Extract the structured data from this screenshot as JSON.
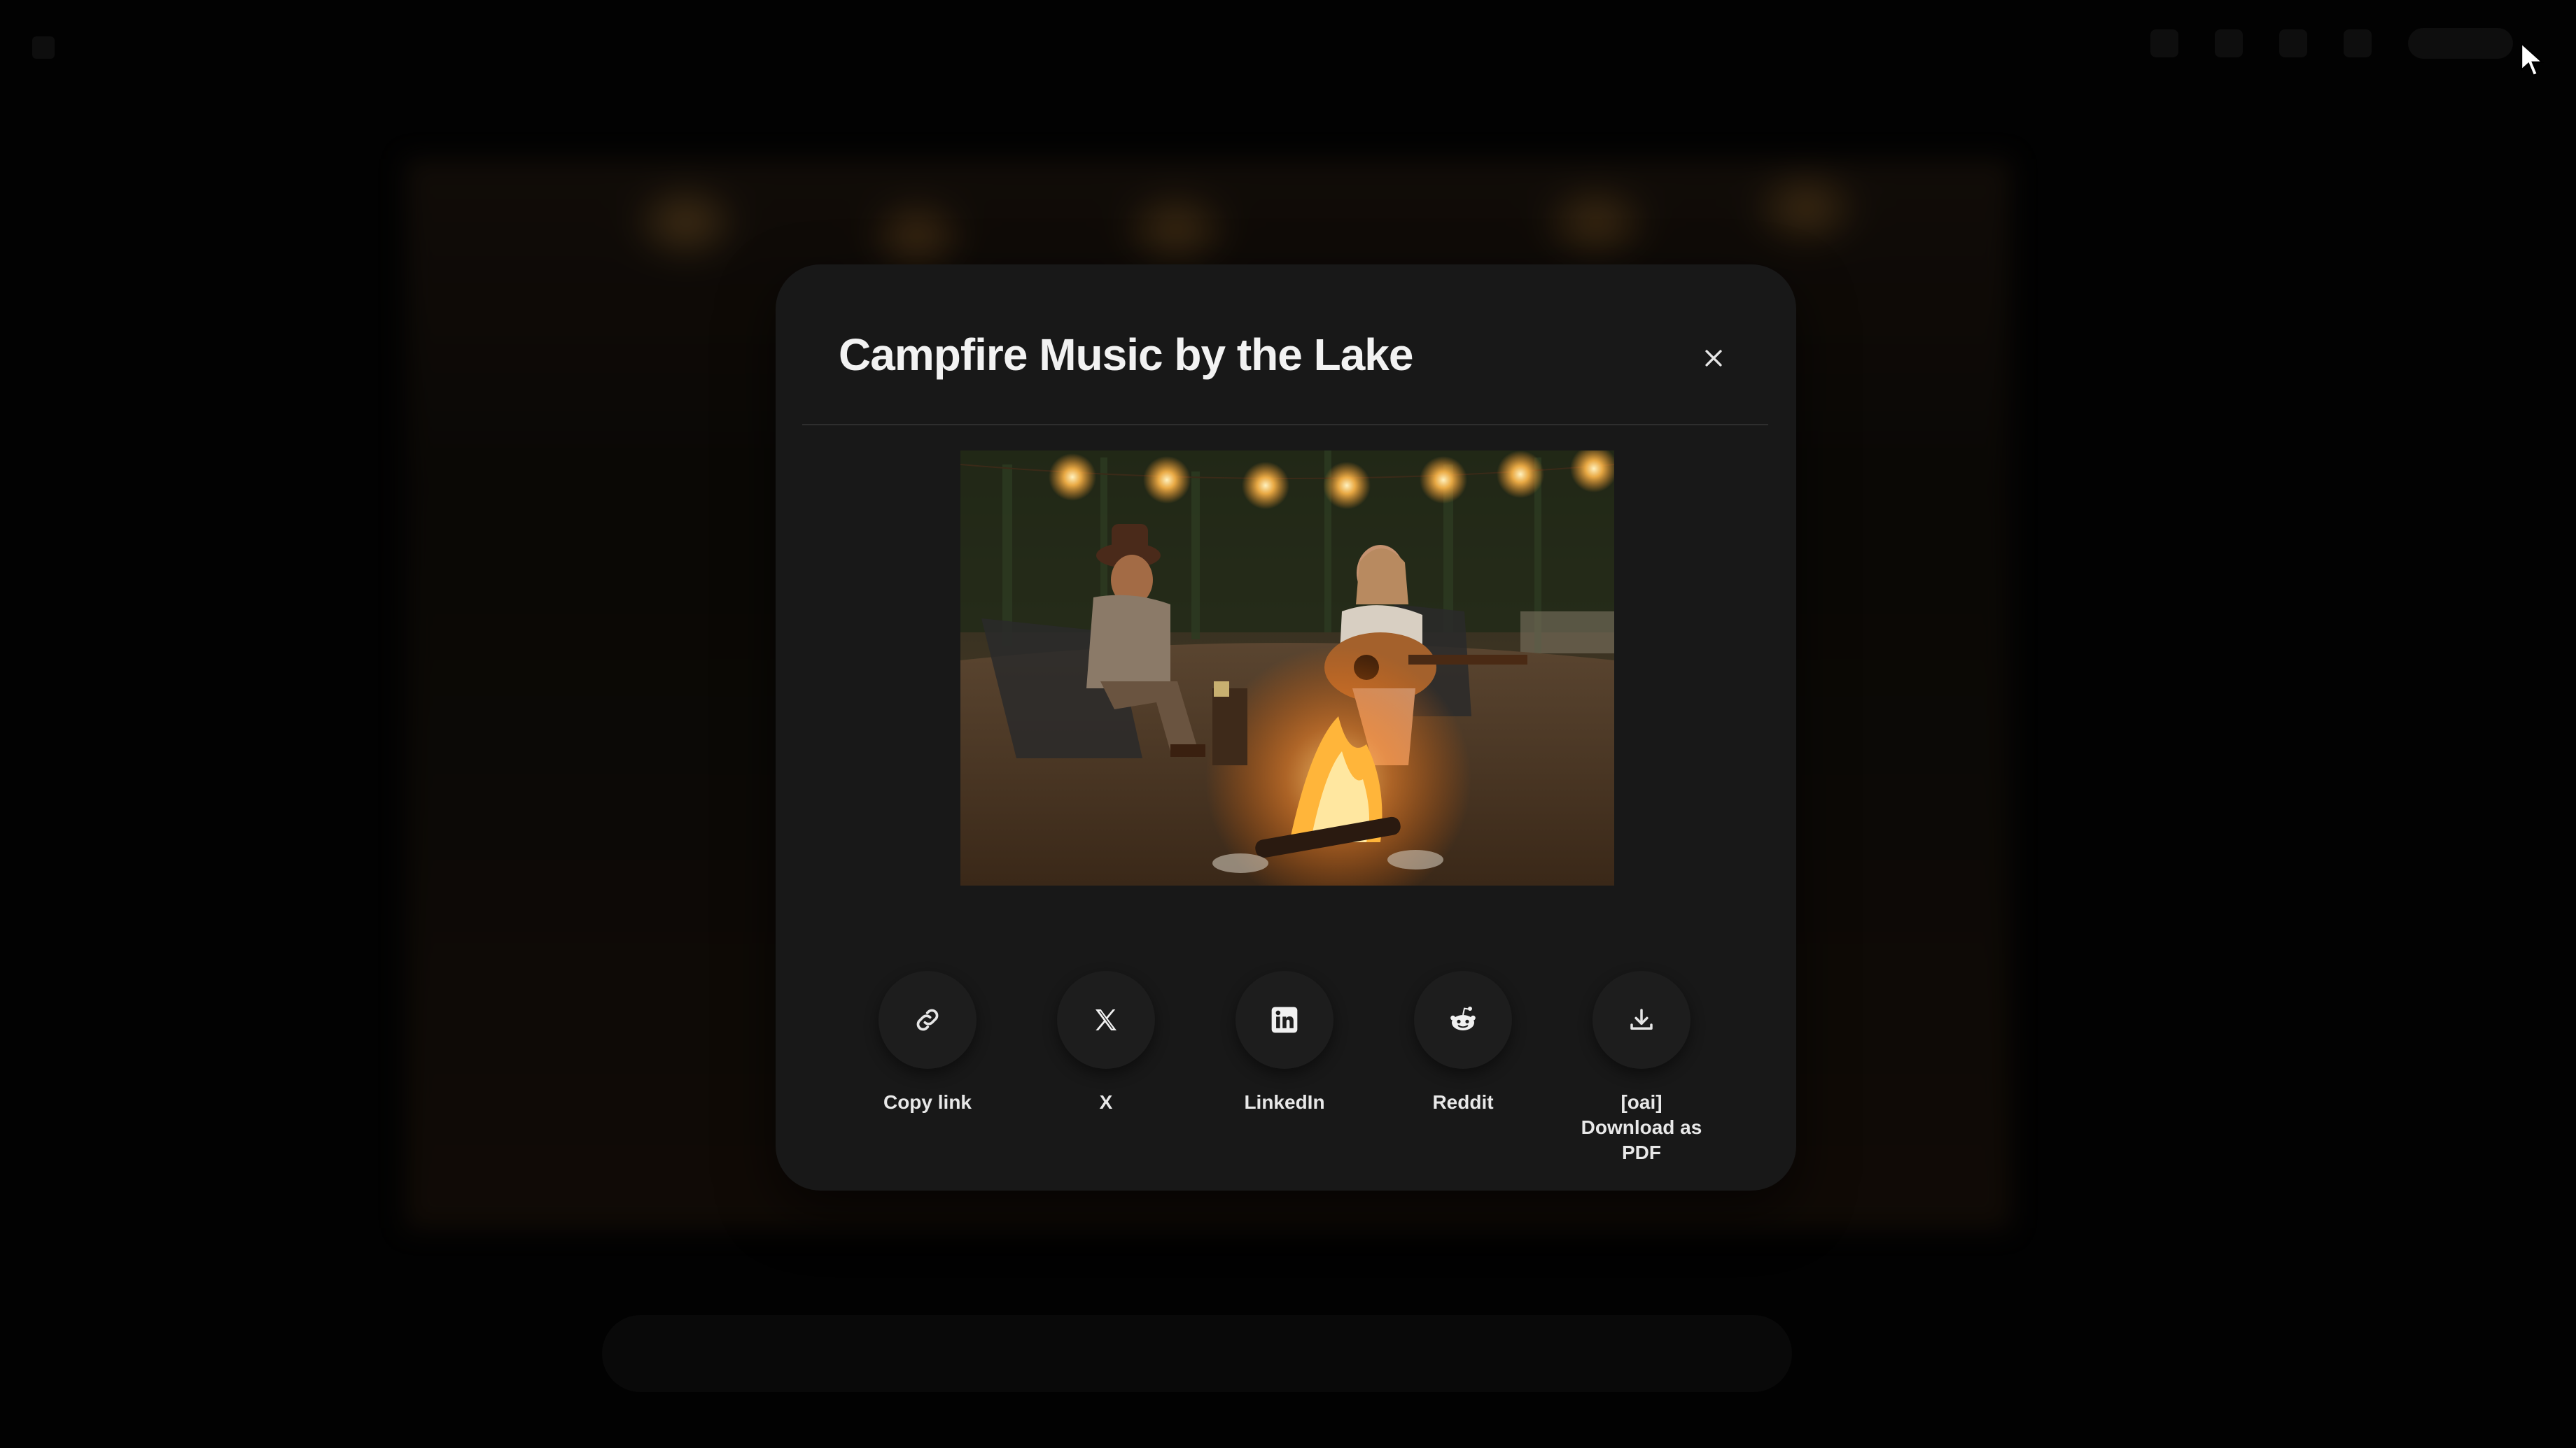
{
  "modal": {
    "title": "Campfire Music by the Lake",
    "close_icon": "close-icon",
    "preview_alt": "Campfire Music by the Lake"
  },
  "share_options": [
    {
      "label": "Copy link",
      "icon": "link-icon"
    },
    {
      "label": "X",
      "icon": "x-logo-icon"
    },
    {
      "label": "LinkedIn",
      "icon": "linkedin-logo-icon"
    },
    {
      "label": "Reddit",
      "icon": "reddit-logo-icon"
    },
    {
      "label": "[oai] Download as PDF",
      "icon": "download-icon"
    }
  ],
  "colors": {
    "modal_bg": "#181818",
    "overlay": "rgba(0,0,0,0.55)",
    "text": "#f2f2f2"
  }
}
